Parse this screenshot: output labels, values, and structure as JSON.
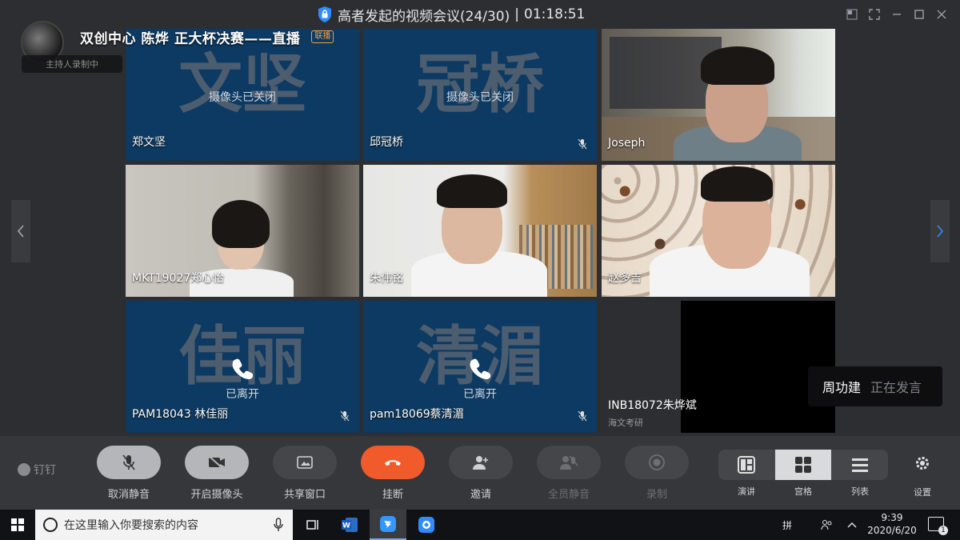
{
  "window": {
    "title": "高者发起的视频会议(24/30)",
    "timer": "01:18:51",
    "title_separator": "|"
  },
  "live": {
    "title": "双创中心 陈烨 正大杯决赛——直播",
    "badge": "联播",
    "recording": "主持人录制中"
  },
  "tiles": [
    {
      "name": "郑文坚",
      "big": "文坚",
      "status": "摄像头已关闭",
      "muted": false
    },
    {
      "name": "邱冠桥",
      "big": "冠桥",
      "status": "摄像头已关闭",
      "muted": true
    },
    {
      "name": "Joseph"
    },
    {
      "name": "MKT19027郑心怡"
    },
    {
      "name": "朱伟铭"
    },
    {
      "name": "赵多吉"
    },
    {
      "name": "PAM18043 林佳丽",
      "big": "佳丽",
      "status": "已离开",
      "muted": true
    },
    {
      "name": "pam18069蔡清湄",
      "big": "清湄",
      "status": "已离开",
      "muted": true
    },
    {
      "name": "INB18072朱烨斌",
      "subtitle": "海文考研"
    }
  ],
  "speaking": {
    "name": "周功建",
    "status": "正在发言"
  },
  "controls": {
    "brand": "钉钉",
    "unmute": "取消静音",
    "camera": "开启摄像头",
    "share": "共享窗口",
    "hangup": "挂断",
    "invite": "邀请",
    "mute_all": "全员静音",
    "record": "录制",
    "layout_speaker": "演讲",
    "layout_grid": "宫格",
    "layout_list": "列表",
    "settings": "设置"
  },
  "taskbar": {
    "search_placeholder": "在这里输入你要搜索的内容",
    "time": "9:39",
    "date": "2020/6/20",
    "ime": "拼",
    "notifications": "1"
  },
  "colors": {
    "tile_off": "#0c3a63",
    "hangup": "#f15a2b",
    "accent_arrow": "#2f8cff",
    "badge": "#f5a04a"
  },
  "icons": [
    "shield-lock-icon",
    "mic-muted-icon",
    "camera-off-icon",
    "share-window-icon",
    "phone-hangup-icon",
    "add-person-icon",
    "mute-all-icon",
    "record-icon",
    "layout-speaker-icon",
    "layout-grid-icon",
    "layout-list-icon",
    "gear-icon",
    "phone-icon",
    "windows-start-icon",
    "search-circle-icon"
  ]
}
